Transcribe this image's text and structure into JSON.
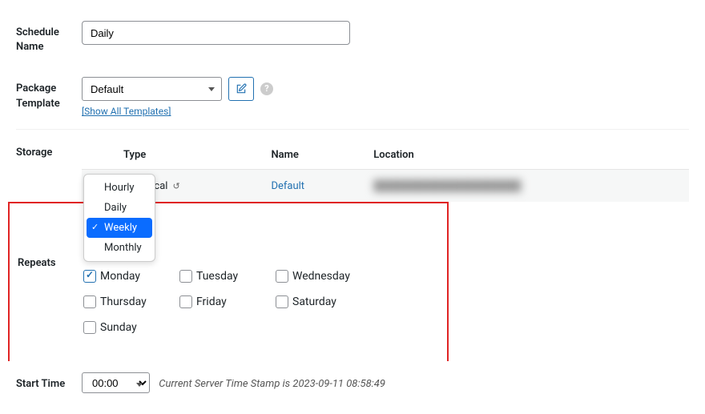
{
  "schedule_name": {
    "label": "Schedule Name",
    "value": "Daily"
  },
  "package_template": {
    "label": "Package Template",
    "selected": "Default",
    "show_all_link": "[Show All Templates]"
  },
  "storage": {
    "label": "Storage",
    "headers": {
      "type": "Type",
      "name": "Name",
      "location": "Location"
    },
    "row": {
      "checked": true,
      "type": "Local",
      "name": "Default",
      "location": "████████████████████"
    }
  },
  "repeats": {
    "label": "Repeats",
    "options": [
      "Hourly",
      "Daily",
      "Weekly",
      "Monthly"
    ],
    "selected": "Weekly",
    "days": [
      {
        "label": "Monday",
        "checked": true
      },
      {
        "label": "Tuesday",
        "checked": false
      },
      {
        "label": "Wednesday",
        "checked": false
      },
      {
        "label": "Thursday",
        "checked": false
      },
      {
        "label": "Friday",
        "checked": false
      },
      {
        "label": "Saturday",
        "checked": false
      },
      {
        "label": "Sunday",
        "checked": false
      }
    ]
  },
  "start_time": {
    "label": "Start Time",
    "value": "00:00",
    "hint_prefix": "Current Server Time Stamp is  ",
    "timestamp": "2023-09-11 08:58:49"
  }
}
